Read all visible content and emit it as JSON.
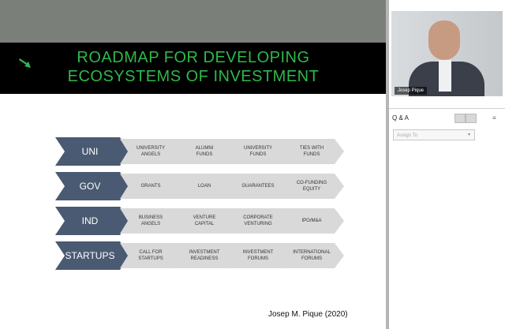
{
  "slide": {
    "title_line1": "ROADMAP FOR DEVELOPING",
    "title_line2": "ECOSYSTEMS OF INVESTMENT",
    "title_color": "#2fb84a",
    "rows": [
      {
        "label": "UNI",
        "cells": [
          "UNIVERSITY\nANGELS",
          "ALUMNI\nFUNDS",
          "UNIVERSITY\nFUNDS",
          "TIES WITH\nFUNDS"
        ]
      },
      {
        "label": "GOV",
        "cells": [
          "GRANTS",
          "LOAN",
          "GUARANTEES",
          "CO-FUNDING\nEQUITY"
        ]
      },
      {
        "label": "IND",
        "cells": [
          "BUSINESS\nANGELS",
          "VENTURE\nCAPITAL",
          "CORPORATE\nVENTURING",
          "IPO/M&A"
        ]
      },
      {
        "label": "STARTUPS",
        "cells": [
          "CALL FOR\nSTARTUPS",
          "INVESTMENT\nREADINESS",
          "INVESTMENT\nFORUMS",
          "INTERNATIONAL\nFORUMS"
        ]
      }
    ],
    "head_color": "#4a5a72",
    "cell_color": "#d9d9d9",
    "credit": "Josep M. Pique (2020)"
  },
  "video": {
    "participant_name": "Josep Pique"
  },
  "qa": {
    "title": "Q & A",
    "assign_placeholder": "Assign To",
    "menu_icon": "menu-icon"
  }
}
